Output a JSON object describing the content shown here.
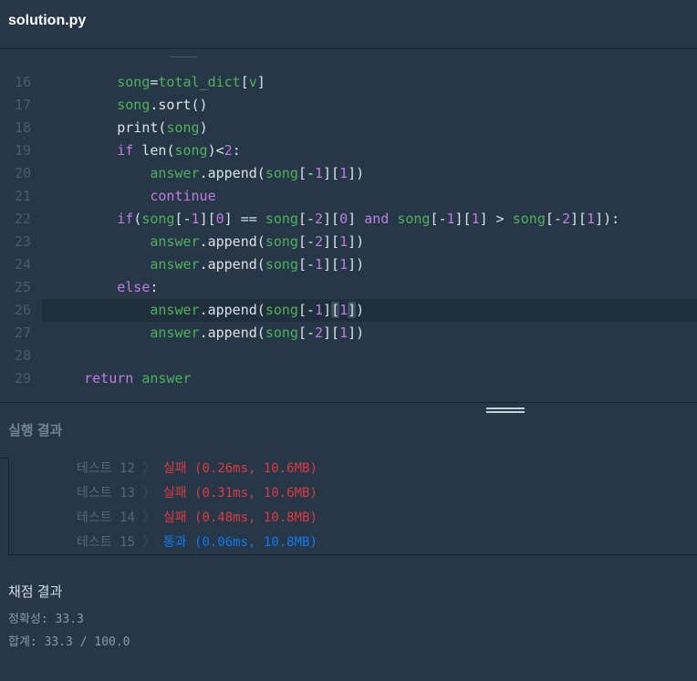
{
  "file": {
    "title": "solution.py"
  },
  "editor": {
    "lines": [
      {
        "num": "16",
        "tokens": [
          {
            "t": "        ",
            "c": ""
          },
          {
            "t": "song",
            "c": "t-var"
          },
          {
            "t": "=",
            "c": "t-op"
          },
          {
            "t": "total_dict",
            "c": "t-var"
          },
          {
            "t": "[",
            "c": "t-op"
          },
          {
            "t": "v",
            "c": "t-var"
          },
          {
            "t": "]",
            "c": "t-op"
          }
        ]
      },
      {
        "num": "17",
        "tokens": [
          {
            "t": "        ",
            "c": ""
          },
          {
            "t": "song",
            "c": "t-var"
          },
          {
            "t": ".",
            "c": "t-op"
          },
          {
            "t": "sort",
            "c": "t-fn"
          },
          {
            "t": "()",
            "c": "t-op"
          }
        ]
      },
      {
        "num": "18",
        "tokens": [
          {
            "t": "        ",
            "c": ""
          },
          {
            "t": "print",
            "c": "t-fn"
          },
          {
            "t": "(",
            "c": "t-op"
          },
          {
            "t": "song",
            "c": "t-var"
          },
          {
            "t": ")",
            "c": "t-op"
          }
        ]
      },
      {
        "num": "19",
        "tokens": [
          {
            "t": "        ",
            "c": ""
          },
          {
            "t": "if",
            "c": "t-kw"
          },
          {
            "t": " ",
            "c": ""
          },
          {
            "t": "len",
            "c": "t-fn"
          },
          {
            "t": "(",
            "c": "t-op"
          },
          {
            "t": "song",
            "c": "t-var"
          },
          {
            "t": ")<",
            "c": "t-op"
          },
          {
            "t": "2",
            "c": "t-num"
          },
          {
            "t": ":",
            "c": "t-op"
          }
        ]
      },
      {
        "num": "20",
        "tokens": [
          {
            "t": "            ",
            "c": ""
          },
          {
            "t": "answer",
            "c": "t-var"
          },
          {
            "t": ".",
            "c": "t-op"
          },
          {
            "t": "append",
            "c": "t-fn"
          },
          {
            "t": "(",
            "c": "t-op"
          },
          {
            "t": "song",
            "c": "t-var"
          },
          {
            "t": "[-",
            "c": "t-op"
          },
          {
            "t": "1",
            "c": "t-num"
          },
          {
            "t": "][",
            "c": "t-op"
          },
          {
            "t": "1",
            "c": "t-num"
          },
          {
            "t": "])",
            "c": "t-op"
          }
        ]
      },
      {
        "num": "21",
        "tokens": [
          {
            "t": "            ",
            "c": ""
          },
          {
            "t": "continue",
            "c": "t-kw"
          }
        ]
      },
      {
        "num": "22",
        "tokens": [
          {
            "t": "        ",
            "c": ""
          },
          {
            "t": "if",
            "c": "t-kw"
          },
          {
            "t": "(",
            "c": "t-op"
          },
          {
            "t": "song",
            "c": "t-var"
          },
          {
            "t": "[-",
            "c": "t-op"
          },
          {
            "t": "1",
            "c": "t-num"
          },
          {
            "t": "][",
            "c": "t-op"
          },
          {
            "t": "0",
            "c": "t-num"
          },
          {
            "t": "] == ",
            "c": "t-op"
          },
          {
            "t": "song",
            "c": "t-var"
          },
          {
            "t": "[-",
            "c": "t-op"
          },
          {
            "t": "2",
            "c": "t-num"
          },
          {
            "t": "][",
            "c": "t-op"
          },
          {
            "t": "0",
            "c": "t-num"
          },
          {
            "t": "] ",
            "c": "t-op"
          },
          {
            "t": "and",
            "c": "t-kw"
          },
          {
            "t": " ",
            "c": ""
          },
          {
            "t": "song",
            "c": "t-var"
          },
          {
            "t": "[-",
            "c": "t-op"
          },
          {
            "t": "1",
            "c": "t-num"
          },
          {
            "t": "][",
            "c": "t-op"
          },
          {
            "t": "1",
            "c": "t-num"
          },
          {
            "t": "] > ",
            "c": "t-op"
          },
          {
            "t": "song",
            "c": "t-var"
          },
          {
            "t": "[-",
            "c": "t-op"
          },
          {
            "t": "2",
            "c": "t-num"
          },
          {
            "t": "][",
            "c": "t-op"
          },
          {
            "t": "1",
            "c": "t-num"
          },
          {
            "t": "]):",
            "c": "t-op"
          }
        ]
      },
      {
        "num": "23",
        "tokens": [
          {
            "t": "            ",
            "c": ""
          },
          {
            "t": "answer",
            "c": "t-var"
          },
          {
            "t": ".",
            "c": "t-op"
          },
          {
            "t": "append",
            "c": "t-fn"
          },
          {
            "t": "(",
            "c": "t-op"
          },
          {
            "t": "song",
            "c": "t-var"
          },
          {
            "t": "[-",
            "c": "t-op"
          },
          {
            "t": "2",
            "c": "t-num"
          },
          {
            "t": "][",
            "c": "t-op"
          },
          {
            "t": "1",
            "c": "t-num"
          },
          {
            "t": "])",
            "c": "t-op"
          }
        ]
      },
      {
        "num": "24",
        "tokens": [
          {
            "t": "            ",
            "c": ""
          },
          {
            "t": "answer",
            "c": "t-var"
          },
          {
            "t": ".",
            "c": "t-op"
          },
          {
            "t": "append",
            "c": "t-fn"
          },
          {
            "t": "(",
            "c": "t-op"
          },
          {
            "t": "song",
            "c": "t-var"
          },
          {
            "t": "[-",
            "c": "t-op"
          },
          {
            "t": "1",
            "c": "t-num"
          },
          {
            "t": "][",
            "c": "t-op"
          },
          {
            "t": "1",
            "c": "t-num"
          },
          {
            "t": "])",
            "c": "t-op"
          }
        ]
      },
      {
        "num": "25",
        "tokens": [
          {
            "t": "        ",
            "c": ""
          },
          {
            "t": "else",
            "c": "t-kw"
          },
          {
            "t": ":",
            "c": "t-op"
          }
        ]
      },
      {
        "num": "26",
        "active": true,
        "tokens": [
          {
            "t": "            ",
            "c": ""
          },
          {
            "t": "answer",
            "c": "t-var"
          },
          {
            "t": ".",
            "c": "t-op"
          },
          {
            "t": "append",
            "c": "t-fn"
          },
          {
            "t": "(",
            "c": "t-op"
          },
          {
            "t": "song",
            "c": "t-var"
          },
          {
            "t": "[-",
            "c": "t-op"
          },
          {
            "t": "1",
            "c": "t-num"
          },
          {
            "t": "]",
            "c": "t-op"
          },
          {
            "t": "[",
            "c": "t-op t-hl"
          },
          {
            "t": "1",
            "c": "t-num"
          },
          {
            "t": "]",
            "c": "t-op t-hl"
          },
          {
            "t": ")",
            "c": "t-op"
          }
        ]
      },
      {
        "num": "27",
        "tokens": [
          {
            "t": "            ",
            "c": ""
          },
          {
            "t": "answer",
            "c": "t-var"
          },
          {
            "t": ".",
            "c": "t-op"
          },
          {
            "t": "append",
            "c": "t-fn"
          },
          {
            "t": "(",
            "c": "t-op"
          },
          {
            "t": "song",
            "c": "t-var"
          },
          {
            "t": "[-",
            "c": "t-op"
          },
          {
            "t": "2",
            "c": "t-num"
          },
          {
            "t": "][",
            "c": "t-op"
          },
          {
            "t": "1",
            "c": "t-num"
          },
          {
            "t": "])",
            "c": "t-op"
          }
        ]
      },
      {
        "num": "28",
        "tokens": []
      },
      {
        "num": "29",
        "tokens": [
          {
            "t": "    ",
            "c": ""
          },
          {
            "t": "return",
            "c": "t-kw"
          },
          {
            "t": " ",
            "c": ""
          },
          {
            "t": "answer",
            "c": "t-var"
          }
        ]
      }
    ]
  },
  "results": {
    "title": "실행 결과",
    "tests": [
      {
        "label": "테스트 12",
        "arrow": "〉",
        "status": "실패",
        "detail": "(0.26ms, 10.6MB)",
        "pass": false
      },
      {
        "label": "테스트 13",
        "arrow": "〉",
        "status": "실패",
        "detail": "(0.31ms, 10.6MB)",
        "pass": false
      },
      {
        "label": "테스트 14",
        "arrow": "〉",
        "status": "실패",
        "detail": "(0.48ms, 10.8MB)",
        "pass": false
      },
      {
        "label": "테스트 15",
        "arrow": "〉",
        "status": "통과",
        "detail": "(0.06ms, 10.8MB)",
        "pass": true
      }
    ]
  },
  "score": {
    "title": "채점 결과",
    "accuracy_label": "정확성:",
    "accuracy_value": "33.3",
    "total_label": "합계:",
    "total_value": "33.3 / 100.0"
  }
}
